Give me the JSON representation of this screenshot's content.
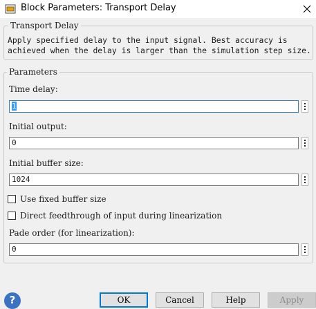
{
  "window": {
    "title": "Block Parameters: Transport Delay"
  },
  "description_group": {
    "legend": "Transport Delay",
    "text": "Apply specified delay to the input signal.  Best accuracy is\nachieved when the delay is larger than the simulation step size."
  },
  "params": {
    "legend": "Parameters",
    "time_delay": {
      "label": "Time delay:",
      "value": "1"
    },
    "initial_output": {
      "label": "Initial output:",
      "value": "0"
    },
    "buffer_size": {
      "label": "Initial buffer size:",
      "value": "1024"
    },
    "use_fixed_buffer": {
      "label": "Use fixed buffer size",
      "checked": false
    },
    "direct_feedthrough": {
      "label": "Direct feedthrough of input during linearization",
      "checked": false
    },
    "pade_order": {
      "label": "Pade order (for linearization):",
      "value": "0"
    }
  },
  "buttons": {
    "ok": "OK",
    "cancel": "Cancel",
    "help": "Help",
    "apply": "Apply"
  },
  "icons": {
    "app": "simulink-block-icon",
    "close": "close-icon",
    "help": "help-question-icon",
    "more": "more-options-icon"
  }
}
